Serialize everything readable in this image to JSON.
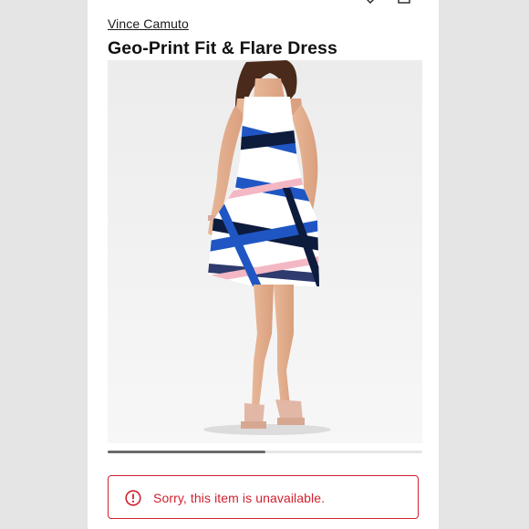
{
  "header": {
    "icons": [
      "heart-icon",
      "shopping-bag-icon"
    ]
  },
  "product": {
    "brand": "Vince Camuto",
    "title": "Geo-Print Fit & Flare Dress",
    "image": {
      "description_icon": "product-photo",
      "dress_colors": [
        "#1f56c4",
        "#0d1b3d",
        "#f3b8c4",
        "#ffffff",
        "#2f3a6e"
      ]
    }
  },
  "carousel": {
    "progress": 0.5
  },
  "availability": {
    "message": "Sorry, this item is unavailable.",
    "icon": "alert-circle-icon",
    "color": "#d0202e"
  }
}
